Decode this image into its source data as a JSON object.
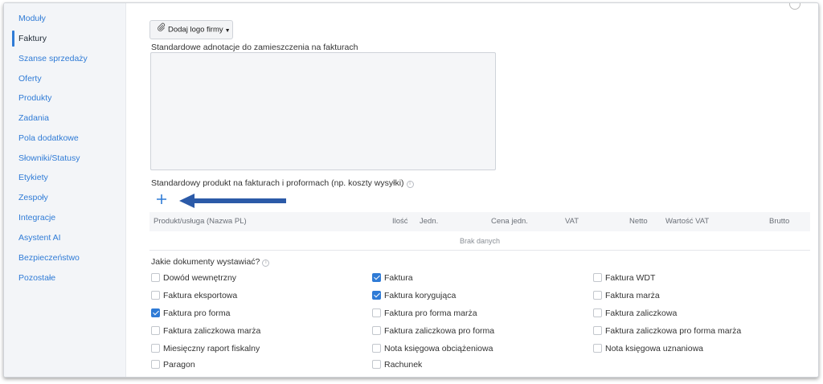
{
  "sidebar": {
    "items": [
      {
        "label": "Moduły",
        "active": false
      },
      {
        "label": "Faktury",
        "active": true
      },
      {
        "label": "Szanse sprzedaży",
        "active": false
      },
      {
        "label": "Oferty",
        "active": false
      },
      {
        "label": "Produkty",
        "active": false
      },
      {
        "label": "Zadania",
        "active": false
      },
      {
        "label": "Pola dodatkowe",
        "active": false
      },
      {
        "label": "Słowniki/Statusy",
        "active": false
      },
      {
        "label": "Etykiety",
        "active": false
      },
      {
        "label": "Zespoły",
        "active": false
      },
      {
        "label": "Integracje",
        "active": false
      },
      {
        "label": "Asystent AI",
        "active": false
      },
      {
        "label": "Bezpieczeństwo",
        "active": false
      },
      {
        "label": "Pozostałe",
        "active": false
      }
    ]
  },
  "main": {
    "logo_button": {
      "label": "Dodaj logo firmy",
      "icon": "paperclip-icon"
    },
    "annotations_label": "Standardowe adnotacje do zamieszczenia na fakturach",
    "annotations_value": "",
    "default_product_label": "Standardowy produkt na fakturach i proformach (np. koszty wysyłki)",
    "add_icon": "plus-icon",
    "table": {
      "columns": [
        "Produkt/usługa (Nazwa PL)",
        "Ilość",
        "Jedn.",
        "Cena jedn.",
        "VAT",
        "Netto",
        "Wartość VAT",
        "Brutto"
      ],
      "empty_text": "Brak danych"
    },
    "documents_label": "Jakie dokumenty wystawiać?",
    "documents": [
      {
        "label": "Dowód wewnętrzny",
        "checked": false
      },
      {
        "label": "Faktura",
        "checked": true
      },
      {
        "label": "Faktura WDT",
        "checked": false
      },
      {
        "label": "Faktura eksportowa",
        "checked": false
      },
      {
        "label": "Faktura korygująca",
        "checked": true
      },
      {
        "label": "Faktura marża",
        "checked": false
      },
      {
        "label": "Faktura pro forma",
        "checked": true
      },
      {
        "label": "Faktura pro forma marża",
        "checked": false
      },
      {
        "label": "Faktura zaliczkowa",
        "checked": false
      },
      {
        "label": "Faktura zaliczkowa marża",
        "checked": false
      },
      {
        "label": "Faktura zaliczkowa pro forma",
        "checked": false
      },
      {
        "label": "Faktura zaliczkowa pro forma marża",
        "checked": false
      },
      {
        "label": "Miesięczny raport fiskalny",
        "checked": false
      },
      {
        "label": "Nota księgowa obciążeniowa",
        "checked": false
      },
      {
        "label": "Nota księgowa uznaniowa",
        "checked": false
      },
      {
        "label": "Paragon",
        "checked": false
      },
      {
        "label": "Rachunek",
        "checked": false
      }
    ],
    "colors": {
      "accent": "#2f7bd6",
      "arrow": "#2b5aa8"
    }
  }
}
